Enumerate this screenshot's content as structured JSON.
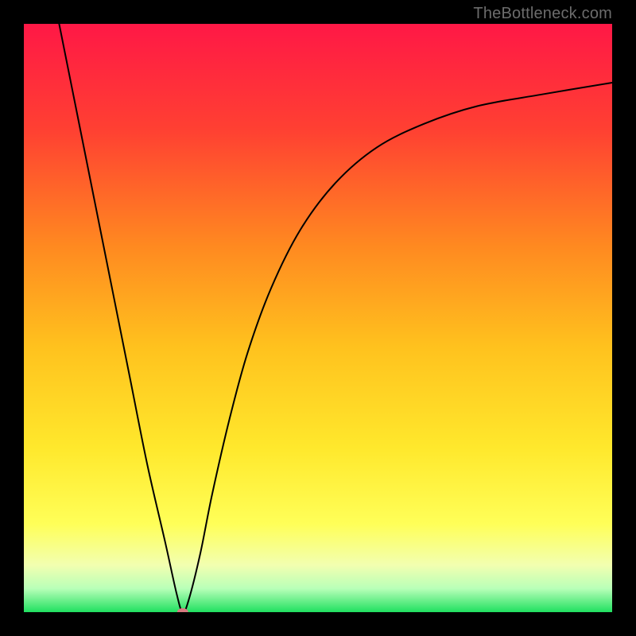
{
  "watermark": "TheBottleneck.com",
  "chart_data": {
    "type": "line",
    "title": "",
    "xlabel": "",
    "ylabel": "",
    "xlim": [
      0,
      100
    ],
    "ylim": [
      0,
      100
    ],
    "grid": false,
    "background_gradient": {
      "top": "#ff1846",
      "mid_top": "#ff7a26",
      "mid": "#ffd024",
      "mid_low": "#ffff45",
      "low": "#f1ffa8",
      "bottom": "#20e060"
    },
    "curve_points": [
      {
        "x": 6,
        "y": 100
      },
      {
        "x": 9,
        "y": 85
      },
      {
        "x": 12,
        "y": 70
      },
      {
        "x": 15,
        "y": 55
      },
      {
        "x": 18,
        "y": 40
      },
      {
        "x": 21,
        "y": 25
      },
      {
        "x": 24,
        "y": 12
      },
      {
        "x": 26,
        "y": 3
      },
      {
        "x": 27,
        "y": 0
      },
      {
        "x": 28,
        "y": 2
      },
      {
        "x": 30,
        "y": 10
      },
      {
        "x": 32,
        "y": 20
      },
      {
        "x": 35,
        "y": 33
      },
      {
        "x": 38,
        "y": 44
      },
      {
        "x": 42,
        "y": 55
      },
      {
        "x": 47,
        "y": 65
      },
      {
        "x": 53,
        "y": 73
      },
      {
        "x": 60,
        "y": 79
      },
      {
        "x": 68,
        "y": 83
      },
      {
        "x": 77,
        "y": 86
      },
      {
        "x": 88,
        "y": 88
      },
      {
        "x": 100,
        "y": 90
      }
    ],
    "marker": {
      "x": 27,
      "y": 0,
      "color": "#d87a80"
    },
    "line_color": "#000000",
    "line_width": 2
  }
}
